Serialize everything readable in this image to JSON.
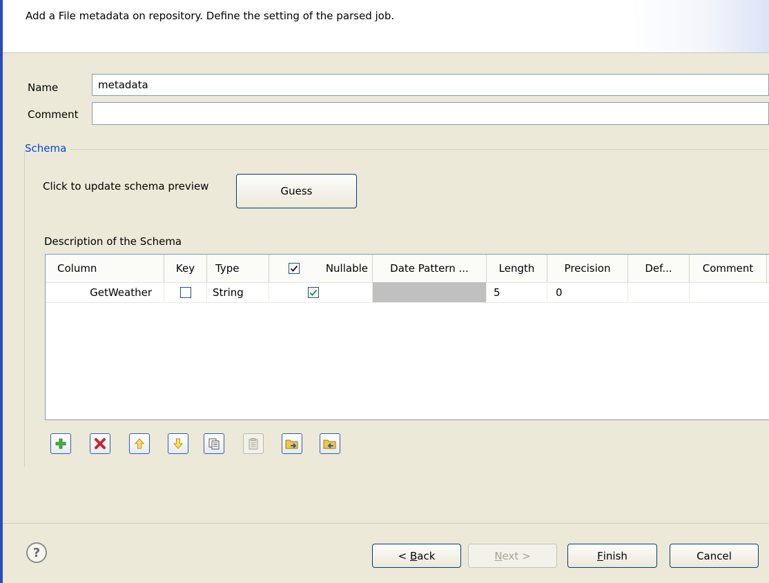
{
  "header": {
    "message": "Add a File metadata on repository. Define the setting of the parsed job."
  },
  "form": {
    "name_label": "Name",
    "name_value": "metadata",
    "comment_label": "Comment",
    "comment_value": ""
  },
  "schema": {
    "group_title": "Schema",
    "update_label": "Click to update schema preview",
    "guess_button": "Guess",
    "description_label": "Description of the Schema",
    "columns": [
      "Column",
      "Key",
      "Type",
      "",
      "Nullable",
      "Date Pattern ...",
      "Length",
      "Precision",
      "Def...",
      "Comment"
    ],
    "header_checkbox_checked": true,
    "rows": [
      {
        "column": "GetWeather",
        "key": false,
        "type": "String",
        "nullable": true,
        "date_pattern": "",
        "length": "5",
        "precision": "0",
        "default": "",
        "comment": ""
      }
    ]
  },
  "toolbar": {
    "buttons": [
      "add-icon",
      "remove-icon",
      "move-up-icon",
      "move-down-icon",
      "copy-icon",
      "paste-icon",
      "import-icon",
      "export-icon"
    ]
  },
  "footer": {
    "help": "?",
    "back_prefix": "< ",
    "back_key": "B",
    "back_rest": "ack",
    "next_key": "N",
    "next_rest": "ext >",
    "finish_key": "F",
    "finish_rest": "inish",
    "cancel": "Cancel"
  },
  "colors": {
    "accent": "#2a4cc0",
    "group_title": "#0046d5",
    "background": "#ece9d8"
  }
}
